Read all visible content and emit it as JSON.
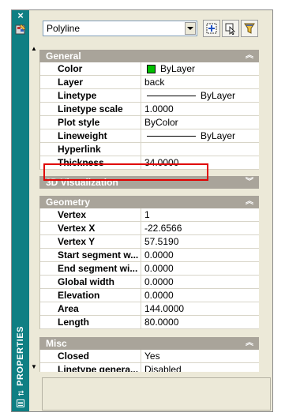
{
  "palette": {
    "title": "PROPERTIES",
    "close_glyph": "×",
    "arrows_glyph": "⇄",
    "teal": "#0f7f83"
  },
  "toolbar": {
    "object_type": "Polyline",
    "buttons": [
      {
        "icon": "quick-select-icon"
      },
      {
        "icon": "select-objects-icon"
      },
      {
        "icon": "filter-icon"
      }
    ]
  },
  "sections": {
    "general": {
      "title": "General",
      "chevron": "︽",
      "rows": [
        {
          "key": "Color",
          "value": "ByLayer",
          "swatch_color": "#00c000"
        },
        {
          "key": "Layer",
          "value": "back"
        },
        {
          "key": "Linetype",
          "value": "ByLayer"
        },
        {
          "key": "Linetype scale",
          "value": "1.0000"
        },
        {
          "key": "Plot style",
          "value": "ByColor"
        },
        {
          "key": "Lineweight",
          "value": "ByLayer"
        },
        {
          "key": "Hyperlink",
          "value": ""
        },
        {
          "key": "Thickness",
          "value": "34.0000"
        }
      ]
    },
    "viz3d": {
      "title": "3D Visualization",
      "chevron": "︾"
    },
    "geometry": {
      "title": "Geometry",
      "chevron": "︽",
      "rows": [
        {
          "key": "Vertex",
          "value": "1"
        },
        {
          "key": "Vertex X",
          "value": "-22.6566"
        },
        {
          "key": "Vertex Y",
          "value": "57.5190"
        },
        {
          "key": "Start segment w...",
          "value": "0.0000"
        },
        {
          "key": "End segment wi...",
          "value": "0.0000"
        },
        {
          "key": "Global width",
          "value": "0.0000"
        },
        {
          "key": "Elevation",
          "value": "0.0000"
        },
        {
          "key": "Area",
          "value": "144.0000"
        },
        {
          "key": "Length",
          "value": "80.0000"
        }
      ]
    },
    "misc": {
      "title": "Misc",
      "chevron": "︽",
      "rows": [
        {
          "key": "Closed",
          "value": "Yes"
        },
        {
          "key": "Linetype genera...",
          "value": "Disabled"
        }
      ]
    }
  },
  "highlight_color": "#e00000"
}
